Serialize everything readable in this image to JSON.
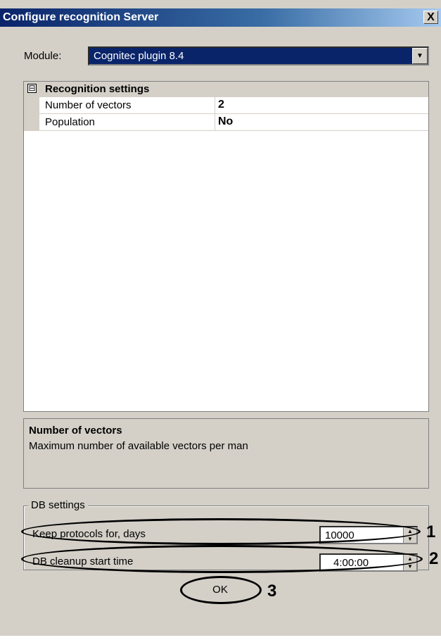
{
  "window": {
    "title": "Configure recognition Server",
    "close_label": "X"
  },
  "module": {
    "label": "Module:",
    "value": "Cognitec plugin 8.4",
    "dropdown_arrow": "▼"
  },
  "grid": {
    "category": {
      "toggle": "⊟",
      "label": "Recognition settings"
    },
    "rows": [
      {
        "name": "Number of vectors",
        "value": "2"
      },
      {
        "name": "Population",
        "value": "No"
      }
    ]
  },
  "description": {
    "title": "Number of vectors",
    "text": "Maximum number of available vectors per man"
  },
  "db_settings": {
    "legend": "DB settings",
    "keep_protocols_label": "Keep protocols for, days",
    "keep_protocols_value": "10000",
    "cleanup_label": "DB cleanup start time",
    "cleanup_value": "4:00:00"
  },
  "ok_label": "OK",
  "callouts": [
    "1",
    "2",
    "3"
  ]
}
